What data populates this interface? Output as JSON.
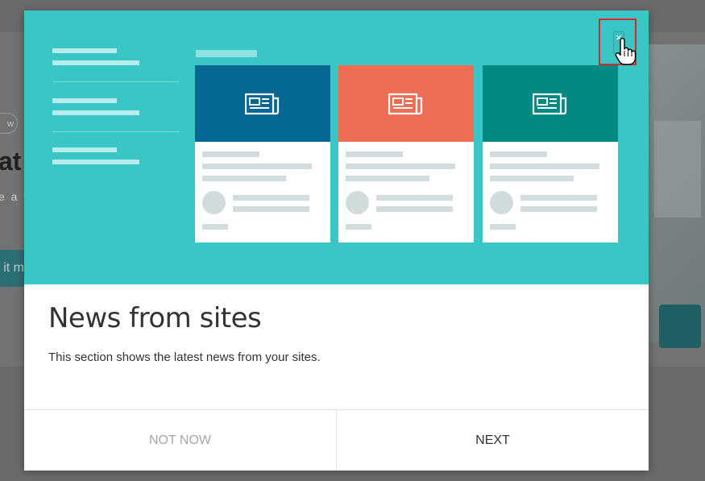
{
  "background": {
    "pill_text": "w",
    "heading_fragment": "at",
    "sub_fragment": "e a t",
    "button_fragment": "it m"
  },
  "modal": {
    "title": "News from sites",
    "description": "This section shows the latest news from your sites.",
    "buttons": {
      "not_now": "NOT NOW",
      "next": "NEXT"
    },
    "close_icon": "close-icon",
    "colors": {
      "hero_background": "#3bc6c6",
      "card_1_header": "#046892",
      "card_2_header": "#ee6e55",
      "card_3_header": "#008983",
      "highlight_border": "#d62828"
    },
    "illustration": {
      "cards": [
        {
          "icon": "newspaper-icon",
          "color": "#046892"
        },
        {
          "icon": "newspaper-icon",
          "color": "#ee6e55"
        },
        {
          "icon": "newspaper-icon",
          "color": "#008983"
        }
      ]
    }
  }
}
